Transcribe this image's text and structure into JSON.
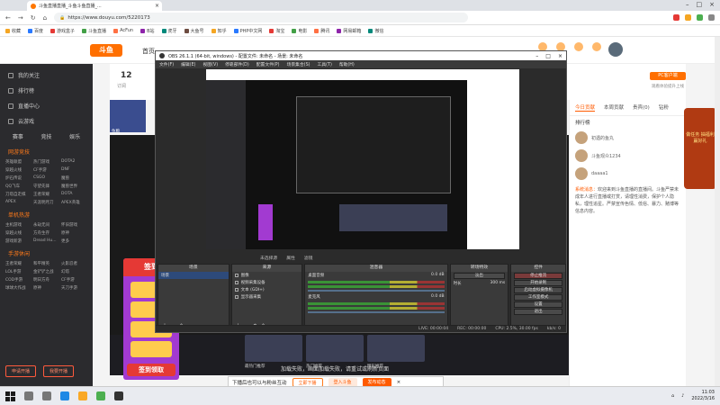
{
  "browser": {
    "tab_title": "斗鱼直播直播_斗鱼斗鱼直播_...",
    "url": "https://www.douyu.com/5220173",
    "bookmarks": [
      "收藏",
      "百度",
      "游戏盒子",
      "斗鱼直播",
      "AcFun",
      "B站",
      "虎牙",
      "大鱼号",
      "知乎",
      "PHP中文网",
      "淘宝",
      "电影",
      "腾讯",
      "网易邮箱",
      "微信"
    ]
  },
  "douyu": {
    "logo_text": "斗鱼",
    "nav_home": "首页",
    "fans_count": "12",
    "fans_label": "订阅",
    "streamer_label": "鱼粮",
    "pc_button": "PC客户端",
    "pc_sub": "观看体验提升上线",
    "sidebar": {
      "items": [
        "我的关注",
        "排行榜",
        "直播中心",
        "云游戏"
      ],
      "icon_row": [
        "赛事",
        "竞技",
        "娱乐"
      ],
      "sec_hot": "网游竞技",
      "hot_grid": [
        "英雄联盟",
        "热门游戏",
        "DOTA2",
        "穿越火线",
        "CF手游",
        "DNF",
        "炉石传说",
        "CSGO",
        "魔兽",
        "QQ飞车",
        "守望先锋",
        "魔兽世界",
        "刀塔自走棋",
        "王者荣耀",
        "DOTA",
        "APEX",
        "天涯明月刀",
        "APEX英雄"
      ],
      "sec_mobile": "单机热游",
      "mobile_grid": [
        "主机游戏",
        "永劫无间",
        "怀旧游戏",
        "穿越火线",
        "方舟生存",
        "原神",
        "游戏新游",
        "Dread Hu...",
        "更多"
      ],
      "sec_phone": "手游休闲",
      "phone_grid": [
        "王者荣耀",
        "和平精英",
        "火影忍者",
        "LOL手游",
        "金铲铲之战",
        "幻塔",
        "COD手游",
        "明日方舟",
        "CF手游",
        "球球大作战",
        "原神",
        "天刀手游"
      ],
      "btn_open": "申请开播",
      "btn_fans": "我要开播"
    },
    "right_panel": {
      "tabs": [
        "今日贡献",
        "本周贡献",
        "贵宾(0)",
        "钻粉"
      ],
      "head": "排行榜",
      "rank": [
        "初遇的鱼丸",
        "斗鱼观众1234",
        "daaaa1"
      ],
      "sys_label": "系统消息：",
      "sys_msg": "欢迎来到斗鱼直播的直播间。斗鱼严禁未成年人进行直播或打赏，请理性消费，保护个人隐私，理性追星。严禁宣传色情、低俗、暴力、赌博等信息内容。"
    },
    "promo": "做任务 抽福利 赢好礼",
    "bottom_cards": [
      {
        "title": "最热门推荐"
      },
      {
        "title": "热门推荐"
      },
      {
        "title": "精彩推荐"
      }
    ],
    "load_fail": "加载失败，画面加载失败，请重试或刷新页面",
    "signin_top": "签到",
    "signin_bottom": "签到领取"
  },
  "obs": {
    "title": "OBS 26.1.1 (64-bit, windows) - 配置文件: 未命名 - 场景: 未命名",
    "menu": [
      "文件(F)",
      "编辑(E)",
      "视图(V)",
      "停靠部件(D)",
      "配置文件(P)",
      "场景集合(S)",
      "工具(T)",
      "帮助(H)"
    ],
    "preview_label": "未选择源",
    "toolbar": [
      "属性",
      "滤镜"
    ],
    "dock_titles": [
      "场景",
      "来源",
      "混音器",
      "转场特效",
      "控件"
    ],
    "scenes": [
      "场景"
    ],
    "sources": [
      "图像",
      "视频采集设备",
      "文本 (GDI+)",
      "显示器采集"
    ],
    "mixer": [
      {
        "name": "桌面音频",
        "db": "0.0 dB"
      },
      {
        "name": "麦克风",
        "db": "0.0 dB"
      }
    ],
    "transition": "淡出",
    "duration_label": "时长",
    "duration": "300 ms",
    "controls": [
      "停止推流",
      "开始录制",
      "启动虚拟摄像机",
      "工作室模式",
      "设置",
      "退出"
    ],
    "status": [
      "LIVE: 00:00:04",
      "REC: 00:00:00",
      "CPU: 2.5%, 30.00 fps",
      "kb/s: 0"
    ]
  },
  "toast": {
    "text": "下播后也可以与粉丝互动",
    "btn_a": "立即下播",
    "btn_b": "登入斗鱼",
    "btn_c": "发布动态"
  },
  "taskbar": {
    "time": "11:03",
    "date": "2022/3/16"
  }
}
